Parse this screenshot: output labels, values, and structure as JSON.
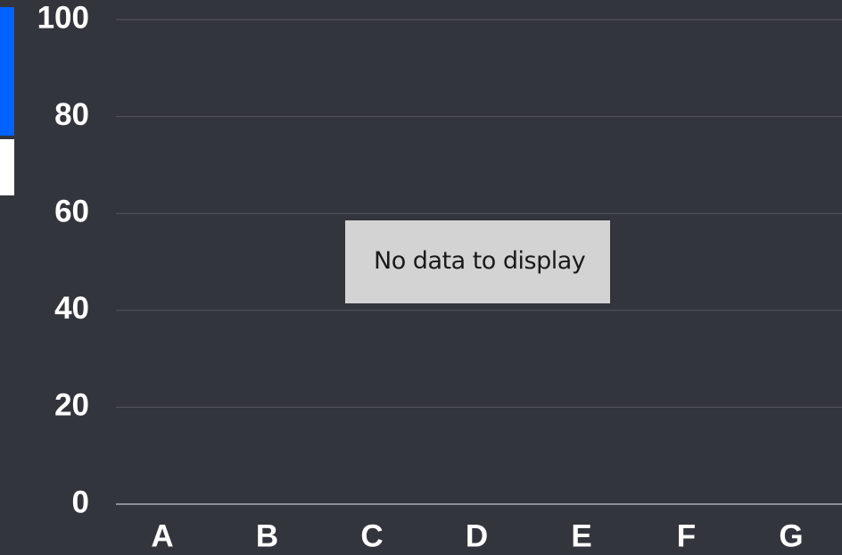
{
  "chart_data": {
    "type": "bar",
    "categories": [
      "A",
      "B",
      "C",
      "D",
      "E",
      "F",
      "G"
    ],
    "series": [],
    "y_ticks": [
      "0",
      "20",
      "40",
      "60",
      "80",
      "100"
    ],
    "ylim": [
      0,
      100
    ],
    "title": "",
    "xlabel": "",
    "ylabel": "",
    "grid": true,
    "empty_message": "No data to display"
  },
  "legend_colors": [
    "#0062ff",
    "#ffffff"
  ],
  "colors": {
    "background": "#33353c",
    "gridline": "#54565c",
    "baseline": "#8d8f94",
    "tick_label": "#ffffff",
    "message_box": "#d3d3d3",
    "message_text": "#1a1a1a"
  }
}
